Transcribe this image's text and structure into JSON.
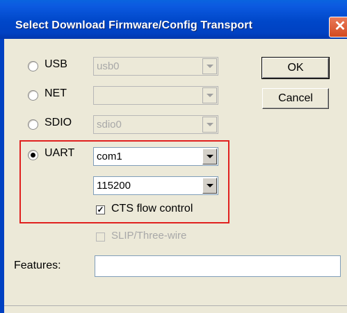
{
  "window": {
    "title": "Select Download Firmware/Config Transport",
    "close_symbol": "✕"
  },
  "transports": {
    "usb": {
      "label": "USB",
      "selected": false,
      "combo_value": "usb0",
      "enabled": false
    },
    "net": {
      "label": "NET",
      "selected": false,
      "combo_value": "",
      "enabled": false
    },
    "sdio": {
      "label": "SDIO",
      "selected": false,
      "combo_value": "sdio0",
      "enabled": false
    },
    "uart": {
      "label": "UART",
      "selected": true,
      "port_value": "com1",
      "baud_value": "115200",
      "enabled": true
    }
  },
  "options": {
    "cts_flow_control": {
      "label": "CTS flow control",
      "checked": true,
      "enabled": true
    },
    "slip_three_wire": {
      "label": "SLIP/Three-wire",
      "checked": false,
      "enabled": false
    }
  },
  "features": {
    "label": "Features:",
    "value": ""
  },
  "buttons": {
    "ok": "OK",
    "cancel": "Cancel"
  },
  "colors": {
    "title_bar": "#0047c9",
    "highlight_box": "#e0201e",
    "dialog_bg": "#ece9d8"
  }
}
